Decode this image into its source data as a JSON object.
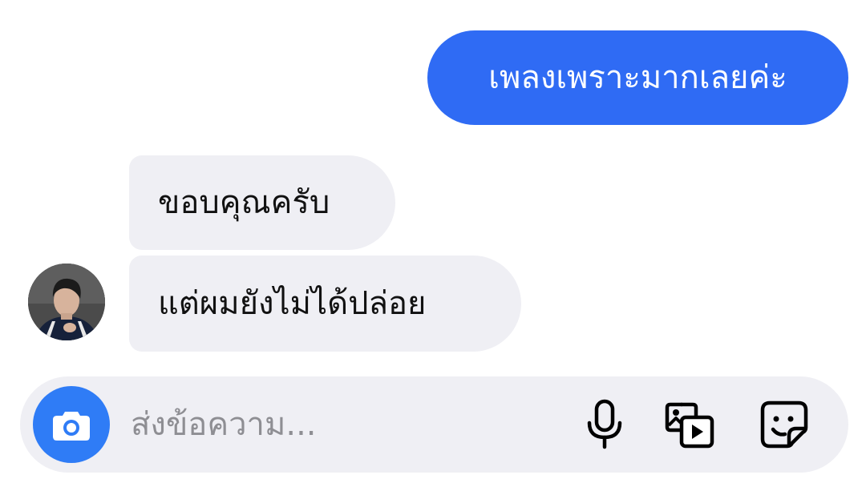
{
  "messages": [
    {
      "direction": "outgoing",
      "text": "เพลงเพราะมากเลยค่ะ"
    },
    {
      "direction": "incoming",
      "text": "ขอบคุณครับ"
    },
    {
      "direction": "incoming",
      "text": "แต่ผมยังไม่ได้ปล่อย"
    }
  ],
  "composer": {
    "placeholder": "ส่งข้อความ...",
    "icons": [
      "camera-icon",
      "microphone-icon",
      "gallery-icon",
      "sticker-icon"
    ]
  },
  "colors": {
    "outgoing_bubble": "#2f6bf4",
    "incoming_bubble": "#efeff4",
    "camera_button": "#2f7cf6",
    "composer_background": "#efeff4",
    "placeholder_text": "#8e8e93"
  }
}
